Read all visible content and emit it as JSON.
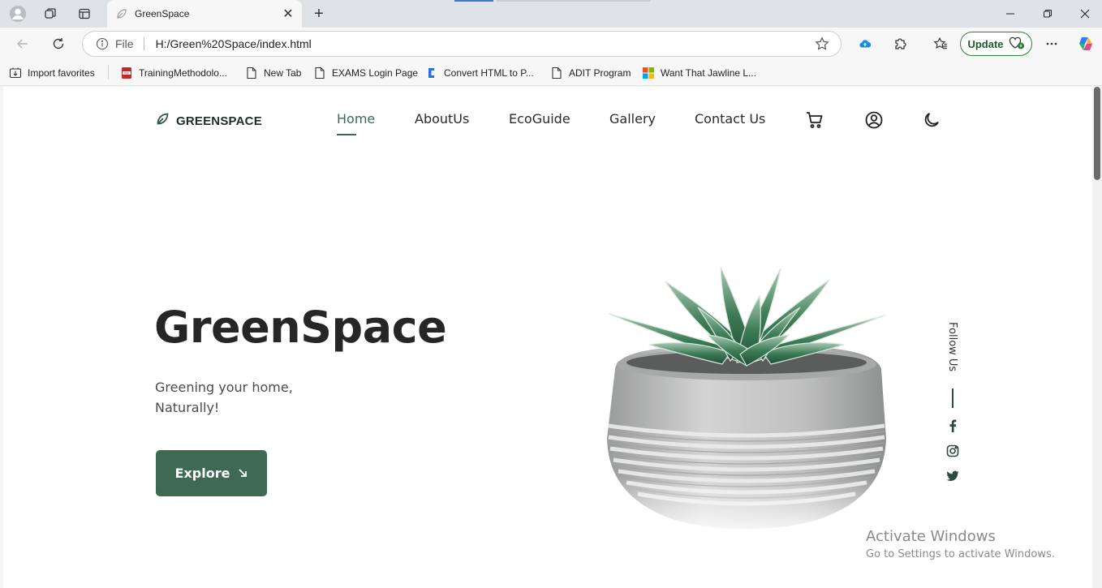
{
  "browser": {
    "tab_title": "GreenSpace",
    "tab_close": "✕",
    "new_tab": "+",
    "address": {
      "scheme": "File",
      "url": "H:/Green%20Space/index.html"
    },
    "update_label": "Update",
    "favorites": [
      {
        "label": "Import favorites",
        "icon": "import-icon"
      },
      {
        "label": "TrainingMethodolo...",
        "icon": "pdf-icon"
      },
      {
        "label": "New Tab",
        "icon": "page-icon"
      },
      {
        "label": "EXAMS Login Page",
        "icon": "page-icon"
      },
      {
        "label": "Convert HTML to P...",
        "icon": "convert-icon"
      },
      {
        "label": "ADIT Program",
        "icon": "page-icon"
      },
      {
        "label": "Want That Jawline L...",
        "icon": "windows-logo-icon"
      }
    ]
  },
  "page": {
    "logo_text": "GREENSPACE",
    "nav": [
      "Home",
      "AboutUs",
      "EcoGuide",
      "Gallery",
      "Contact Us"
    ],
    "active_nav": "Home",
    "hero": {
      "title": "GreenSpace",
      "subtitle_line1": "Greening your home,",
      "subtitle_line2": "Naturally!",
      "button_label": "Explore"
    },
    "follow_label": "Follow Us",
    "social": [
      "facebook-icon",
      "instagram-icon",
      "twitter-icon"
    ],
    "accent_color": "#3e6a54"
  },
  "watermark": {
    "line1": "Activate Windows",
    "line2": "Go to Settings to activate Windows."
  }
}
